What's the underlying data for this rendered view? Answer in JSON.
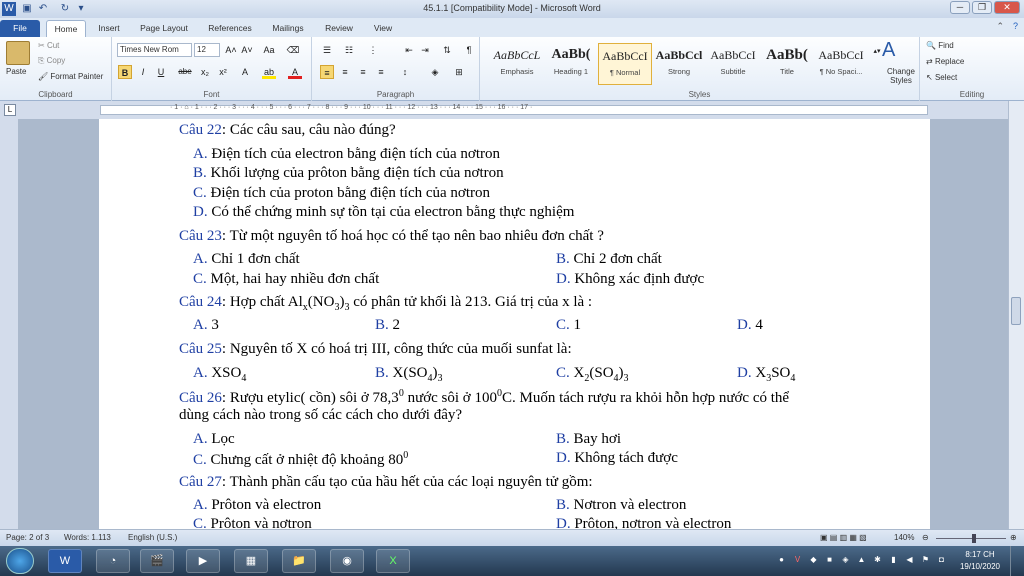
{
  "window": {
    "title": "45.1.1 [Compatibility Mode] - Microsoft Word",
    "min": "─",
    "max": "❐",
    "close": "✕"
  },
  "qat": [
    "W",
    "💾",
    "↶",
    "↻",
    "▾"
  ],
  "tabs": [
    "File",
    "Home",
    "Insert",
    "Page Layout",
    "References",
    "Mailings",
    "Review",
    "View"
  ],
  "clipboard": {
    "paste": "Paste",
    "cut": "Cut",
    "copy": "Copy",
    "format_painter": "Format Painter",
    "label": "Clipboard"
  },
  "font": {
    "name": "Times New Rom",
    "size": "12",
    "label": "Font",
    "bold": "B",
    "italic": "I",
    "underline": "U",
    "strike": "abe",
    "sub": "x₂",
    "sup": "x²",
    "grow": "A˄",
    "shrink": "A˅",
    "case": "Aa"
  },
  "paragraph": {
    "label": "Paragraph",
    "pilcrow": "¶"
  },
  "styles": {
    "label": "Styles",
    "items": [
      {
        "sample": "AaBbCcL",
        "name": "Emphasis"
      },
      {
        "sample": "AaBb(",
        "name": "Heading 1"
      },
      {
        "sample": "AaBbCcI",
        "name": "¶ Normal"
      },
      {
        "sample": "AaBbCcl",
        "name": "Strong"
      },
      {
        "sample": "AaBbCcI",
        "name": "Subtitle"
      },
      {
        "sample": "AaBb(",
        "name": "Title"
      },
      {
        "sample": "AaBbCcI",
        "name": "¶ No Spaci..."
      }
    ],
    "change": "Change Styles"
  },
  "editing": {
    "label": "Editing",
    "find": "Find",
    "replace": "Replace",
    "select": "Select"
  },
  "ruler": "· 1 · ⌂ · 1 · · · 2 · · · 3 · · · 4 · · · 5 · · · 6 · · · 7 · · · 8 · · · 9 · · · 10 · · · 11 · · · 12 · · · 13 · · · 14 · · · 15 · · · 16 · · · 17 ·",
  "doc": {
    "q22": {
      "label": "Câu 22",
      "text": ": Các câu sau, câu nào đúng?"
    },
    "q22a": {
      "l": "A.",
      "t": " Điện tích của electron bằng điện tích của nơtron"
    },
    "q22b": {
      "l": "B.",
      "t": " Khối lượng của prôton bằng điện tích của nơtron"
    },
    "q22c": {
      "l": "C.",
      "t": " Điện tích của proton bằng điện tích của nơtron"
    },
    "q22d": {
      "l": "D.",
      "t": " Có thể chứng minh sự tồn tại của electron bằng thực nghiệm"
    },
    "q23": {
      "label": "Câu 23",
      "text": ": Từ một nguyên tố hoá học có thể tạo nên bao nhiêu đơn chất ?"
    },
    "q23a": {
      "l": "A.",
      "t": " Chỉ 1 đơn chất"
    },
    "q23b": {
      "l": "B.",
      "t": " Chỉ 2 đơn chất"
    },
    "q23c": {
      "l": "C.",
      "t": " Một, hai hay  nhiều đơn chất"
    },
    "q23d": {
      "l": "D.",
      "t": " Không xác định được"
    },
    "q24": {
      "label": "Câu 24",
      "t1": ": Hợp chất Al",
      "s1": "x",
      "t2": "(NO",
      "s2": "3",
      "t3": ")",
      "s3": "3",
      "t4": " có phân tử khối là 213. Giá trị của x là :"
    },
    "q24a": {
      "l": "A.",
      "t": " 3"
    },
    "q24b": {
      "l": "B.",
      "t": " 2"
    },
    "q24c": {
      "l": "C.",
      "t": " 1"
    },
    "q24d": {
      "l": "D.",
      "t": " 4"
    },
    "q25": {
      "label": "Câu 25",
      "text": ": Nguyên tố X có hoá trị III, công thức của muối sunfat là:"
    },
    "q25a": {
      "l": "A.",
      "t": " XSO",
      "s": "4"
    },
    "q25b": {
      "l": "B.",
      "t": " X(SO",
      "s": "4",
      "t2": ")",
      "s2": "3"
    },
    "q25c": {
      "l": "C.",
      "t": " X",
      "s": "2",
      "t2": "(SO",
      "s2": "4",
      "t3": ")",
      "s3": "3"
    },
    "q25d": {
      "l": "D.",
      "t": " X",
      "s": "3",
      "t2": "SO",
      "s2": "4"
    },
    "q26": {
      "label": "Câu 26",
      "t1": ": Rượu etylic( cồn) sôi ở 78,3",
      "p1": "0",
      "t2": " nước sôi ở 100",
      "p2": "0",
      "t3": "C. Muốn tách rượu ra khỏi hỗn hợp nước có thể"
    },
    "q26b": "dùng cách nào trong số các cách cho dưới đây?",
    "q26a_": {
      "l": "A.",
      "t": " Lọc"
    },
    "q26b_": {
      "l": "B.",
      "t": " Bay hơi"
    },
    "q26c_": {
      "l": "C.",
      "t": " Chưng cất ở nhiệt độ khoảng 80",
      "p": "0"
    },
    "q26d_": {
      "l": "D.",
      "t": " Không tách được"
    },
    "q27": {
      "label": "Câu 27",
      "text": ": Thành phần cấu tạo của hầu hết của các loại nguyên tử gồm:"
    },
    "q27a": {
      "l": "A.",
      "t": " Prôton và electron"
    },
    "q27b": {
      "l": "B.",
      "t": " Nơtron và  electron"
    },
    "q27c": {
      "l": "C.",
      "t": " Prôton và nơtron"
    },
    "q27d": {
      "l": "D.",
      "t": " Prôton, nơtron và electron"
    }
  },
  "status": {
    "page": "Page: 2 of 3",
    "words": "Words: 1.113",
    "lang": "English (U.S.)",
    "zoom": "140%"
  },
  "clock": {
    "time": "8:17 CH",
    "date": "19/10/2020"
  }
}
